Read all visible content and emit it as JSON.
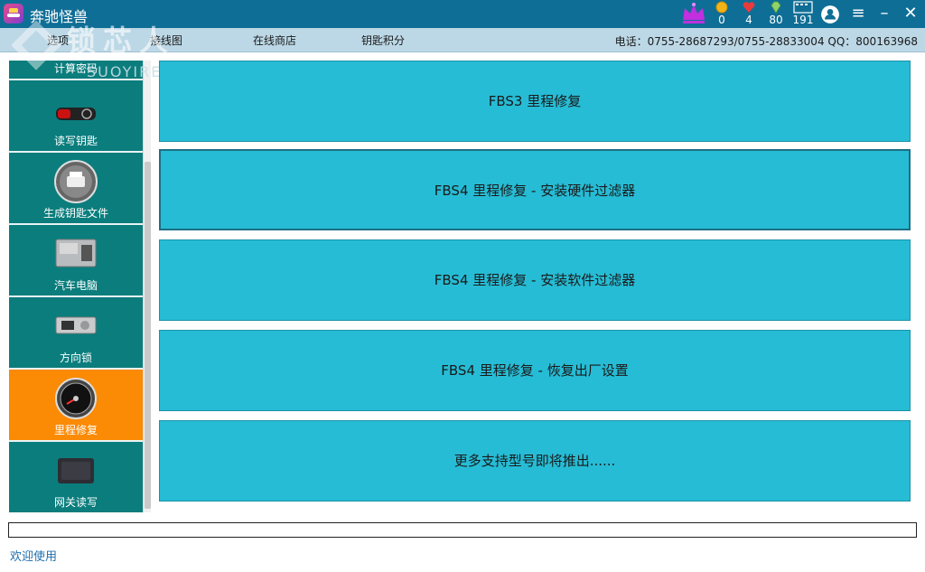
{
  "window": {
    "title": "奔驰怪兽"
  },
  "stats": [
    {
      "icon": "coin-icon",
      "value": "0",
      "color": "#f2b418"
    },
    {
      "icon": "heart-icon",
      "value": "4",
      "color": "#e83a3a"
    },
    {
      "icon": "diamond-icon",
      "value": "80",
      "color": "#8fd36a"
    },
    {
      "icon": "calendar-icon",
      "value": "191",
      "color": "#ffffff"
    }
  ],
  "menu": [
    "选项",
    "接线图",
    "在线商店",
    "钥匙积分"
  ],
  "contact": "电话：0755-28687293/0755-28833004  QQ：800163968",
  "watermark": {
    "cn": "锁芯人",
    "en": "SUOYIREN.COM"
  },
  "sidebar": {
    "items": [
      {
        "label": "计算密码",
        "icon": "password-icon"
      },
      {
        "label": "读写钥匙",
        "icon": "car-key-icon"
      },
      {
        "label": "生成钥匙文件",
        "icon": "printer-icon"
      },
      {
        "label": "汽车电脑",
        "icon": "ecu-icon"
      },
      {
        "label": "方向锁",
        "icon": "steering-lock-icon"
      },
      {
        "label": "里程修复",
        "icon": "speedometer-icon",
        "active": true
      },
      {
        "label": "网关读写",
        "icon": "gateway-module-icon"
      }
    ]
  },
  "main": {
    "buttons": [
      "FBS3  里程修复",
      "FBS4  里程修复  -  安装硬件过滤器",
      "FBS4  里程修复  -  安装软件过滤器",
      "FBS4 里程修复  -  恢复出厂设置",
      "更多支持型号即将推出......"
    ],
    "selected_index": 1
  },
  "status": {
    "text": "欢迎使用",
    "progress": 0
  },
  "colors": {
    "titlebar": "#0f6e96",
    "menubar": "#bcd8e6",
    "sidebar": "#0b7d7d",
    "active": "#fb8a05",
    "button": "#26bcd5"
  }
}
